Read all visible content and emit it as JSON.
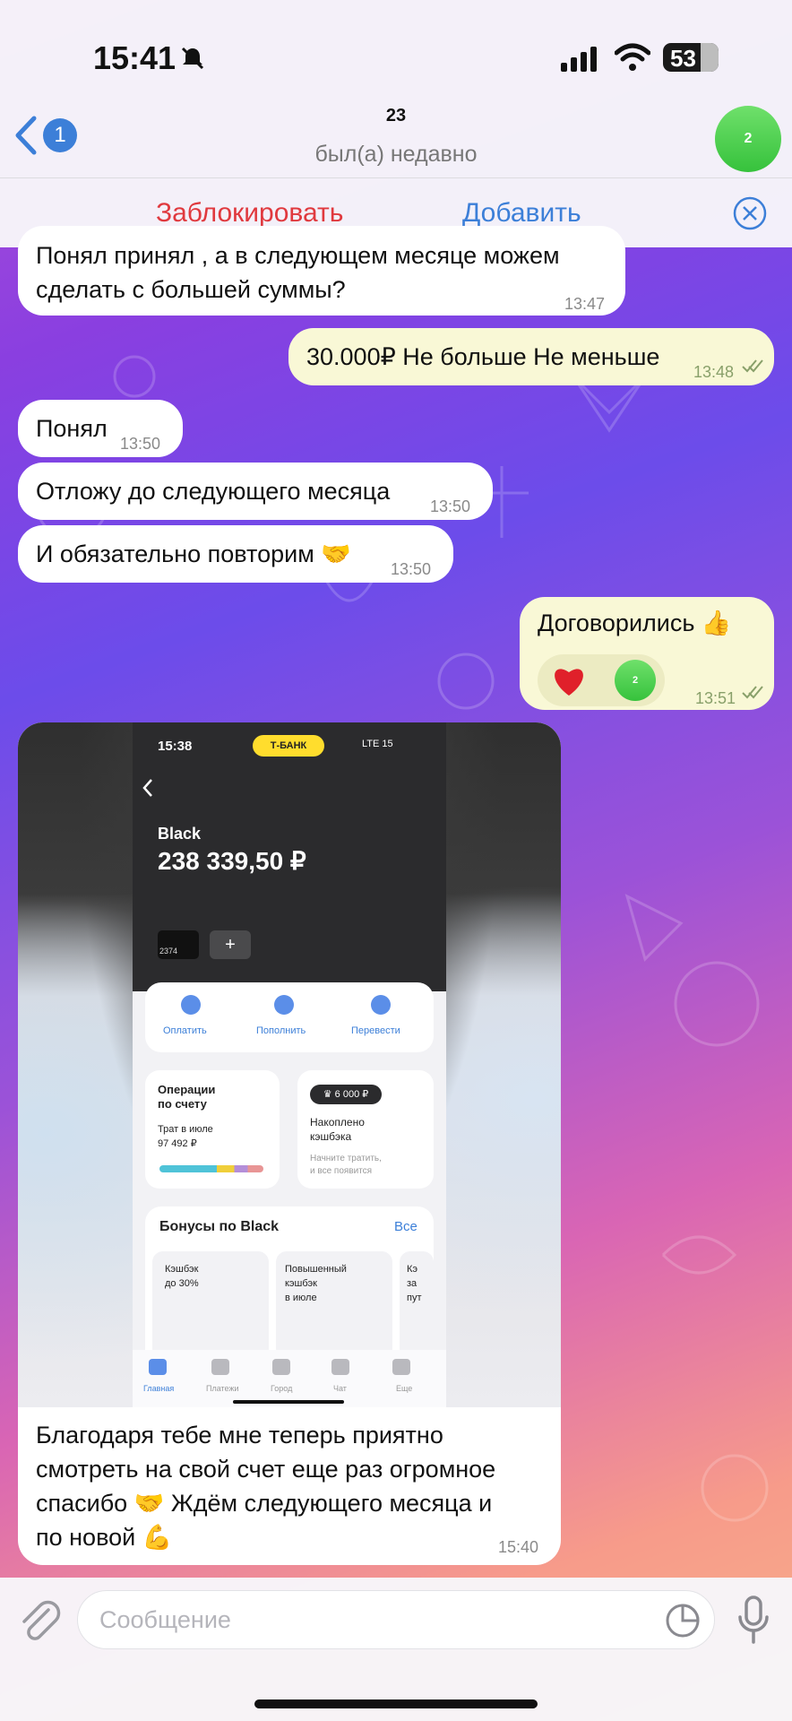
{
  "status_bar": {
    "time": "15:41",
    "battery": "53"
  },
  "header": {
    "back_count": "1",
    "title": "23",
    "subtitle": "был(а) недавно",
    "avatar_label": "2"
  },
  "actions": {
    "block": "Заблокировать",
    "add": "Добавить"
  },
  "messages": [
    {
      "text1": "Понял принял , а в следующем месяце можем",
      "text2": "сделать с большей суммы?",
      "time": "13:47"
    },
    {
      "text": "30.000₽ Не больше Не меньше",
      "time": "13:48"
    },
    {
      "text": "Понял",
      "time": "13:50"
    },
    {
      "text": "Отложу до следующего месяца",
      "time": "13:50"
    },
    {
      "text": "И обязательно повторим 🤝",
      "time": "13:50"
    },
    {
      "text": "Договорились 👍",
      "time": "13:51",
      "reaction": "❤",
      "reaction_avatar": "2"
    }
  ],
  "photo": {
    "time": "15:38",
    "bank": "Т-БАНК",
    "status": "LTE 15",
    "account": "Black",
    "balance": "238 339,50 ₽",
    "card_number": "2374",
    "plus": "+",
    "actions": [
      "Оплатить",
      "Пополнить",
      "Перевести"
    ],
    "ops_title1": "Операции",
    "ops_title2": "по счету",
    "ops_spent1": "Трат в июле",
    "ops_spent2": "97 492 ₽",
    "cashback_badge": "♛ 6 000 ₽",
    "cashback_title1": "Накоплено",
    "cashback_title2": "кэшбэка",
    "cashback_hint1": "Начните тратить,",
    "cashback_hint2": "и все появится",
    "bonus_title": "Бонусы по Black",
    "bonus_all": "Все",
    "bonus_cards": [
      [
        "Кэшбэк",
        "до 30%"
      ],
      [
        "Повышенный",
        "кэшбэк",
        "в июле"
      ],
      [
        "Кэ",
        "за",
        "пут"
      ]
    ],
    "tabs": [
      "Главная",
      "Платежи",
      "Город",
      "Чат",
      "Еще"
    ]
  },
  "caption": {
    "lines": [
      "Благодаря тебе мне теперь приятно",
      "смотреть на свой счет еще раз огромное",
      "спасибо 🤝 Ждём следующего месяца и",
      "по новой 💪"
    ],
    "time": "15:40"
  },
  "input": {
    "placeholder": "Сообщение"
  }
}
